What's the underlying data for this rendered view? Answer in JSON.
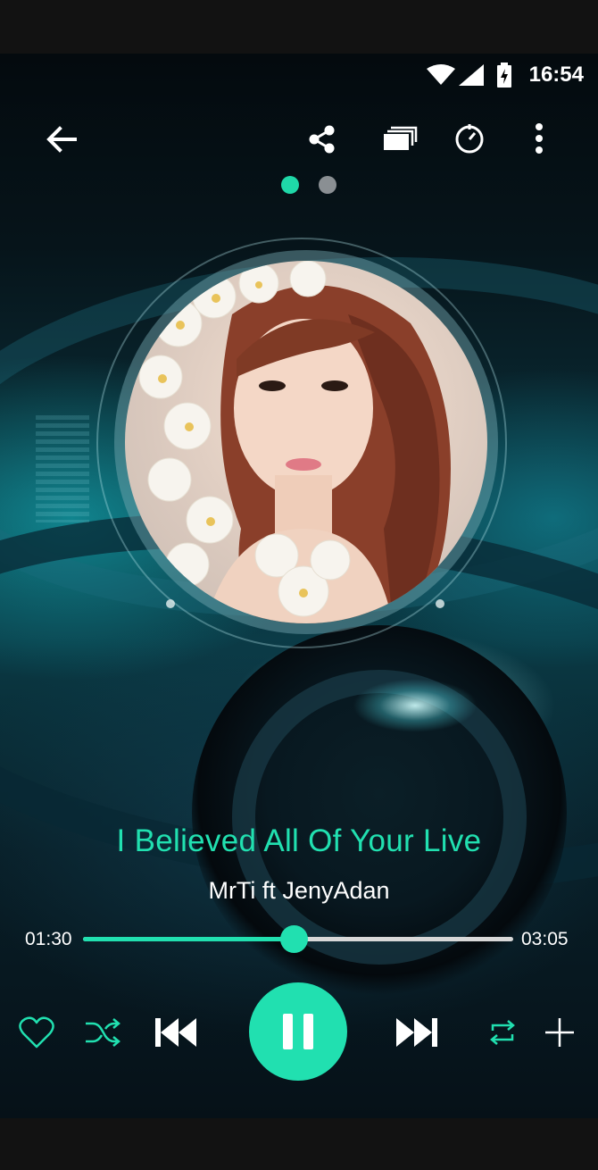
{
  "status_bar": {
    "time": "16:54",
    "icons": [
      "wifi-icon",
      "signal-icon",
      "battery-charging-icon"
    ]
  },
  "toolbar": {
    "back_icon": "arrow-left-icon",
    "share_icon": "share-icon",
    "queue_icon": "queue-stack-icon",
    "timer_icon": "sleep-timer-icon",
    "more_icon": "more-vertical-icon"
  },
  "pager": {
    "pages": 2,
    "active": 1
  },
  "player": {
    "title": "I Believed All Of Your Live",
    "artist": "MrTi ft JenyAdan",
    "elapsed": "01:30",
    "duration": "03:05",
    "progress_fraction": 0.49
  },
  "controls": {
    "icons": [
      "heart-outline-icon",
      "shuffle-icon",
      "skip-previous-icon",
      "pause-icon",
      "skip-next-icon",
      "repeat-icon",
      "plus-icon"
    ]
  },
  "colors": {
    "accent": "#21e0b0",
    "track": "#d8d8d8",
    "inactive_dot": "#8a8f93"
  }
}
